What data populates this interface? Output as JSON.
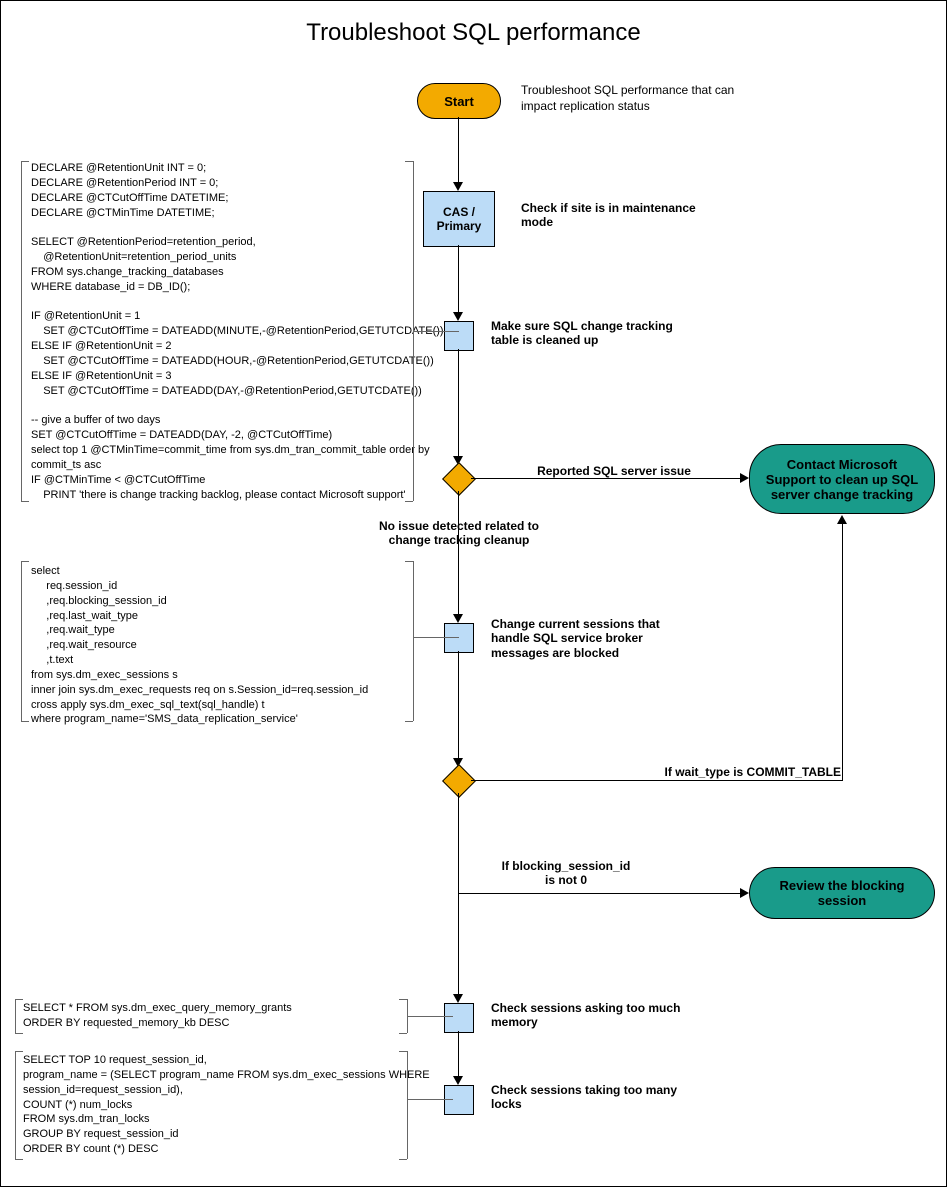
{
  "title": "Troubleshoot SQL performance",
  "start": {
    "label": "Start",
    "note": "Troubleshoot SQL performance that can impact replication status"
  },
  "nodes": {
    "cas_primary": {
      "label": "CAS /\nPrimary",
      "note": "Check if site is in maintenance mode"
    },
    "change_tracking_clean": {
      "note": "Make sure SQL change tracking table is cleaned up"
    },
    "sessions_blocked": {
      "note": "Change current sessions that handle SQL service broker messages are blocked"
    },
    "check_memory": {
      "note": "Check sessions asking too much memory"
    },
    "check_locks": {
      "note": "Check sessions taking too many locks"
    }
  },
  "decisions": {
    "d1_right": "Reported SQL server issue",
    "d1_down": "No issue detected related to\nchange tracking cleanup",
    "d2_right": "If wait_type is COMMIT_TABLE",
    "d2_down": "If blocking_session_id\nis not 0"
  },
  "terminators": {
    "contact_support": "Contact Microsoft Support to clean up SQL server change tracking",
    "review_blocking": "Review the blocking session"
  },
  "code": {
    "sql1": "DECLARE @RetentionUnit INT = 0;\nDECLARE @RetentionPeriod INT = 0;\nDECLARE @CTCutOffTime DATETIME;\nDECLARE @CTMinTime DATETIME;\n\nSELECT @RetentionPeriod=retention_period,\n    @RetentionUnit=retention_period_units\nFROM sys.change_tracking_databases\nWHERE database_id = DB_ID();\n\nIF @RetentionUnit = 1\n    SET @CTCutOffTime = DATEADD(MINUTE,-@RetentionPeriod,GETUTCDATE())\nELSE IF @RetentionUnit = 2\n    SET @CTCutOffTime = DATEADD(HOUR,-@RetentionPeriod,GETUTCDATE())\nELSE IF @RetentionUnit = 3\n    SET @CTCutOffTime = DATEADD(DAY,-@RetentionPeriod,GETUTCDATE())\n\n-- give a buffer of two days\nSET @CTCutOffTime = DATEADD(DAY, -2, @CTCutOffTime)\nselect top 1 @CTMinTime=commit_time from sys.dm_tran_commit_table order by\ncommit_ts asc\nIF @CTMinTime < @CTCutOffTime\n    PRINT 'there is change tracking backlog, please contact Microsoft support'",
    "sql2": "select\n     req.session_id\n     ,req.blocking_session_id\n     ,req.last_wait_type\n     ,req.wait_type\n     ,req.wait_resource\n     ,t.text\nfrom sys.dm_exec_sessions s\ninner join sys.dm_exec_requests req on s.Session_id=req.session_id\ncross apply sys.dm_exec_sql_text(sql_handle) t\nwhere program_name='SMS_data_replication_service'",
    "sql3": "SELECT * FROM sys.dm_exec_query_memory_grants\nORDER BY requested_memory_kb DESC",
    "sql4": "SELECT TOP 10 request_session_id,\nprogram_name = (SELECT program_name FROM sys.dm_exec_sessions WHERE\nsession_id=request_session_id),\nCOUNT (*) num_locks\nFROM sys.dm_tran_locks\nGROUP BY request_session_id\nORDER BY count (*) DESC"
  }
}
